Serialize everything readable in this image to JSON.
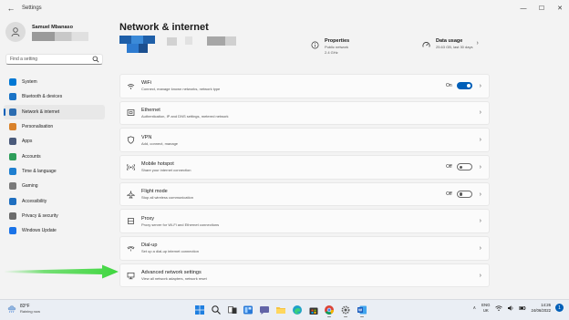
{
  "window": {
    "title": "Settings",
    "minimize": "—",
    "maximize": "☐",
    "close": "✕"
  },
  "user": {
    "name": "Samuel Mbanaso"
  },
  "search": {
    "placeholder": "Find a setting"
  },
  "nav": [
    {
      "label": "System",
      "color": "#0078d4"
    },
    {
      "label": "Bluetooth & devices",
      "color": "#1a73c6"
    },
    {
      "label": "Network & internet",
      "color": "#2b6cb0"
    },
    {
      "label": "Personalisation",
      "color": "#d9822b"
    },
    {
      "label": "Apps",
      "color": "#4a5a7a"
    },
    {
      "label": "Accounts",
      "color": "#2e9e5a"
    },
    {
      "label": "Time & language",
      "color": "#1f7fd0"
    },
    {
      "label": "Gaming",
      "color": "#7a7a7a"
    },
    {
      "label": "Accessibility",
      "color": "#1f6fc0"
    },
    {
      "label": "Privacy & security",
      "color": "#6b6b6b"
    },
    {
      "label": "Windows Update",
      "color": "#1a73e8"
    }
  ],
  "page": {
    "title": "Network & internet"
  },
  "properties": {
    "title": "Properties",
    "line1": "Public network",
    "line2": "2.4 GHz"
  },
  "data_usage": {
    "title": "Data usage",
    "line1": "25.63 GB, last 30 days"
  },
  "cards": [
    {
      "title": "WiFi",
      "desc": "Connect, manage known networks, network type",
      "toggle": "on",
      "toggle_label": "On",
      "icon": "wifi-icon"
    },
    {
      "title": "Ethernet",
      "desc": "Authentication, IP and DNS settings, metered network",
      "icon": "ethernet-icon"
    },
    {
      "title": "VPN",
      "desc": "Add, connect, manage",
      "icon": "vpn-shield-icon"
    },
    {
      "title": "Mobile hotspot",
      "desc": "Share your internet connection",
      "toggle": "off",
      "toggle_label": "Off",
      "icon": "hotspot-icon"
    },
    {
      "title": "Flight mode",
      "desc": "Stop all wireless communication",
      "toggle": "off",
      "toggle_label": "Off",
      "icon": "airplane-icon"
    },
    {
      "title": "Proxy",
      "desc": "Proxy server for Wi-Fi and Ethernet connections",
      "icon": "proxy-icon"
    },
    {
      "title": "Dial-up",
      "desc": "Set up a dial-up internet connection",
      "icon": "dialup-icon"
    },
    {
      "title": "Advanced network settings",
      "desc": "View all network adapters, network reset",
      "icon": "monitor-network-icon"
    }
  ],
  "taskbar": {
    "weather_temp": "83°F",
    "weather_cond": "Raining now",
    "lang_top": "ENG",
    "lang_bottom": "UK",
    "time": "14:26",
    "date": "24/06/2022",
    "notifications": "1",
    "tray_chevron": "∧"
  },
  "colors": {
    "accent": "#005fb8",
    "arrow": "#3fd63f"
  }
}
